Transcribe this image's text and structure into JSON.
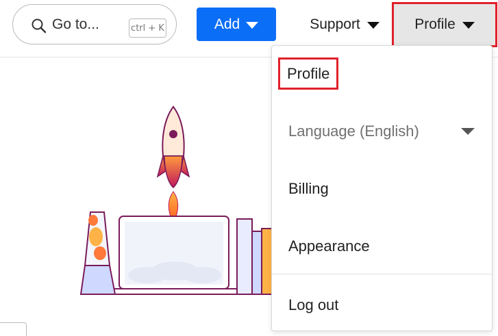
{
  "header": {
    "search": {
      "text": "Go to...",
      "shortcut": "ctrl + K",
      "icon": "search-icon"
    },
    "add_label": "Add",
    "support_label": "Support",
    "profile_label": "Profile"
  },
  "profile_menu": {
    "items": [
      {
        "label": "Profile"
      },
      {
        "label": "Language (English)"
      },
      {
        "label": "Billing"
      },
      {
        "label": "Appearance"
      },
      {
        "label": "Log out"
      }
    ]
  },
  "colors": {
    "primary": "#0b6ef6",
    "highlight_outline": "#e0202a",
    "profile_button_bg": "#e6e6e6"
  }
}
